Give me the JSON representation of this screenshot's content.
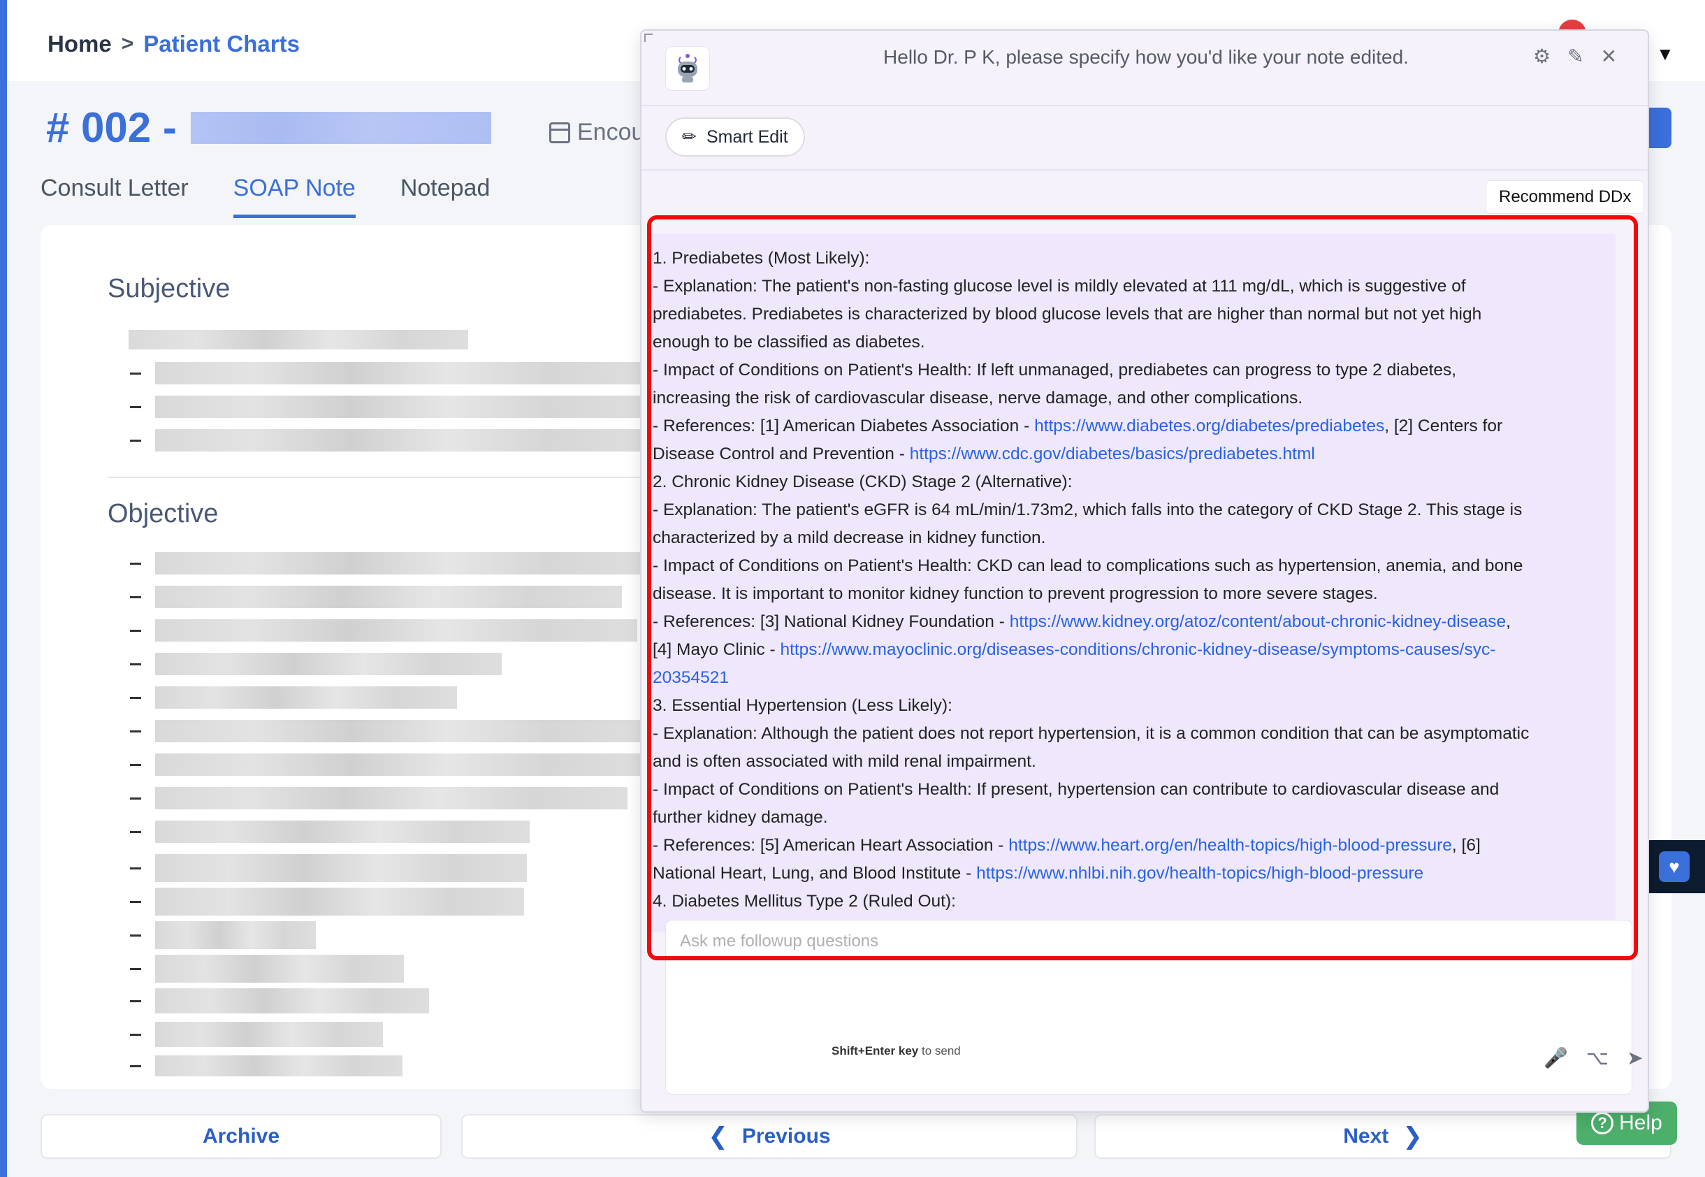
{
  "breadcrumb": {
    "home": "Home",
    "separator": ">",
    "current": "Patient Charts"
  },
  "patient": {
    "title": "# 002 -",
    "encounter_label": "Encou"
  },
  "tabs": [
    {
      "label": "Consult Letter",
      "active": false
    },
    {
      "label": "SOAP Note",
      "active": true
    },
    {
      "label": "Notepad",
      "active": false
    }
  ],
  "sections": {
    "subjective": "Subjective",
    "objective": "Objective"
  },
  "bottom": {
    "archive": "Archive",
    "previous": "Previous",
    "next": "Next"
  },
  "help": {
    "label": "Help"
  },
  "panel": {
    "greeting": "Hello Dr. P K, please specify how you'd like your note edited.",
    "smart_edit": "Smart Edit",
    "recommend_chip": "Recommend DDx",
    "input_placeholder": "Ask me followup questions",
    "hint_key": "Shift+Enter key",
    "hint_rest": "to send"
  },
  "message_lines": [
    {
      "text": "1. Prediabetes (Most Likely):"
    },
    {
      "text": "- Explanation: The patient's non-fasting glucose level is mildly elevated at 111 mg/dL, which is suggestive of"
    },
    {
      "text": "prediabetes. Prediabetes is characterized by blood glucose levels that are higher than normal but not yet high"
    },
    {
      "text": "enough to be classified as diabetes."
    },
    {
      "text": "- Impact of Conditions on Patient's Health: If left unmanaged, prediabetes can progress to type 2 diabetes,"
    },
    {
      "text": "increasing the risk of cardiovascular disease, nerve damage, and other complications."
    },
    {
      "pre": "- References: [1] American Diabetes Association - ",
      "link": "https://www.diabetes.org/diabetes/prediabetes",
      "post": ", [2] Centers for"
    },
    {
      "pre": "Disease Control and Prevention - ",
      "link": "https://www.cdc.gov/diabetes/basics/prediabetes.html",
      "post": ""
    },
    {
      "text": "2. Chronic Kidney Disease (CKD) Stage 2 (Alternative):"
    },
    {
      "text": "- Explanation: The patient's eGFR is 64 mL/min/1.73m2, which falls into the category of CKD Stage 2. This stage is"
    },
    {
      "text": "characterized by a mild decrease in kidney function."
    },
    {
      "text": "- Impact of Conditions on Patient's Health: CKD can lead to complications such as hypertension, anemia, and bone"
    },
    {
      "text": "disease. It is important to monitor kidney function to prevent progression to more severe stages."
    },
    {
      "pre": "- References: [3] National Kidney Foundation - ",
      "link": "https://www.kidney.org/atoz/content/about-chronic-kidney-disease",
      "post": ","
    },
    {
      "pre": "[4] Mayo Clinic - ",
      "link": "https://www.mayoclinic.org/diseases-conditions/chronic-kidney-disease/symptoms-causes/syc-",
      "post": ""
    },
    {
      "pre": "",
      "link": "20354521",
      "post": ""
    },
    {
      "text": "3. Essential Hypertension (Less Likely):"
    },
    {
      "text": "- Explanation: Although the patient does not report hypertension, it is a common condition that can be asymptomatic"
    },
    {
      "text": "and is often associated with mild renal impairment."
    },
    {
      "text": "- Impact of Conditions on Patient's Health: If present, hypertension can contribute to cardiovascular disease and"
    },
    {
      "text": "further kidney damage."
    },
    {
      "pre": "- References: [5] American Heart Association - ",
      "link": "https://www.heart.org/en/health-topics/high-blood-pressure",
      "post": ", [6]"
    },
    {
      "pre": "National Heart, Lung, and Blood Institute - ",
      "link": "https://www.nhlbi.nih.gov/health-topics/high-blood-pressure",
      "post": ""
    },
    {
      "text": "4. Diabetes Mellitus Type 2 (Ruled Out):"
    }
  ],
  "colors": {
    "accent": "#3b6fd9",
    "link": "#2563eb",
    "highlight": "#f00a0a",
    "help": "#4caf6a"
  },
  "icons": [
    "chevron-right-icon",
    "calendar-icon",
    "robot-avatar-icon",
    "sliders-icon",
    "edit-icon",
    "close-icon",
    "pencil-icon",
    "microphone-icon",
    "option-key-icon",
    "send-icon",
    "help-icon",
    "heart-monitor-icon",
    "caret-down-icon"
  ]
}
